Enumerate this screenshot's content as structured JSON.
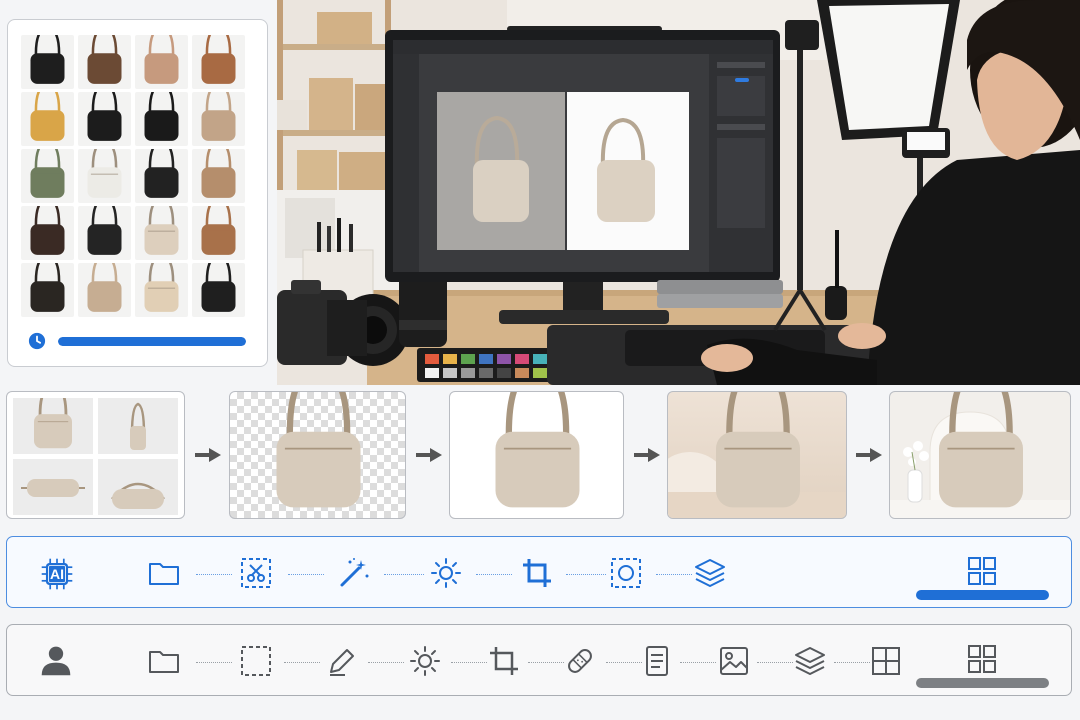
{
  "colors": {
    "accent": "#1f6fd6",
    "manual_gray": "#6a6d71",
    "panel_border": "#c9ccd1"
  },
  "catalog": {
    "progress": 1.0,
    "icons": [
      "clock-icon"
    ],
    "bag_colors": [
      "#1e1e1e",
      "#6b4a34",
      "#c69a7e",
      "#a86a43",
      "#d9a548",
      "#1c1c1c",
      "#1a1a1a",
      "#c2a488",
      "#6f7d5e",
      "#ecebe6",
      "#222222",
      "#b58e6c",
      "#3a2a24",
      "#242424",
      "#ddcfbd",
      "#a8714a",
      "#2a2622",
      "#c6ad92",
      "#e1cfb5",
      "#1f1f1f"
    ]
  },
  "pipeline": {
    "steps": [
      "multi-view-photos",
      "background-removed",
      "white-background",
      "studio-scene",
      "lifestyle-scene"
    ],
    "bag_color": "#d7cbbb",
    "strap_color": "#a8967f"
  },
  "ai_toolbar": {
    "badge": "AI",
    "tools": [
      "folder-icon",
      "select-cut-icon",
      "magic-wand-icon",
      "brightness-icon",
      "crop-icon",
      "focus-select-icon",
      "layers-icon",
      "grid-icon"
    ],
    "progress": 1.0
  },
  "manual_toolbar": {
    "tools": [
      "user-icon",
      "folder-icon",
      "marquee-icon",
      "pen-icon",
      "brightness-icon",
      "crop-icon",
      "healing-bandage-icon",
      "document-icon",
      "image-icon",
      "layers-icon",
      "split-grid-icon",
      "grid-icon"
    ],
    "progress": 1.0
  }
}
